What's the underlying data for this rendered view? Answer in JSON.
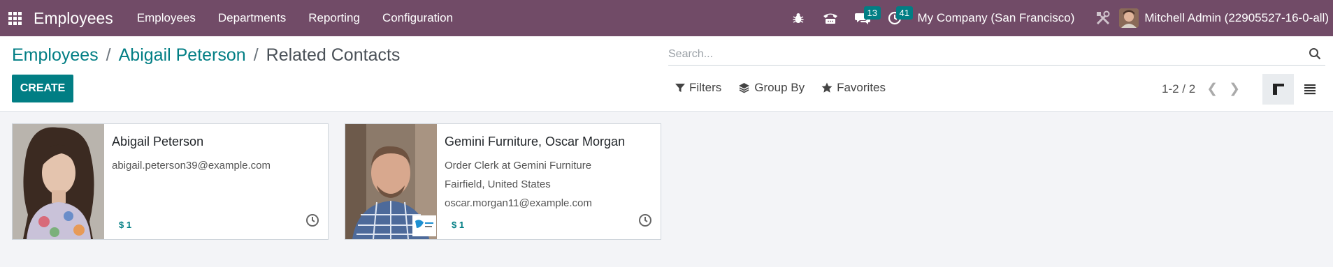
{
  "navbar": {
    "app_name": "Employees",
    "menu": [
      "Employees",
      "Departments",
      "Reporting",
      "Configuration"
    ],
    "messages_count": "13",
    "activities_count": "41",
    "company": "My Company (San Francisco)",
    "user": "Mitchell Admin (22905527-16-0-all)"
  },
  "breadcrumb": {
    "root": "Employees",
    "parent": "Abigail Peterson",
    "current": "Related Contacts",
    "separator": "/"
  },
  "create_label": "CREATE",
  "search": {
    "placeholder": "Search..."
  },
  "filters": {
    "filters": "Filters",
    "group_by": "Group By",
    "favorites": "Favorites"
  },
  "pager": {
    "text": "1-2 / 2"
  },
  "cards": [
    {
      "name": "Abigail Peterson",
      "lines": [
        "abigail.peterson39@example.com"
      ],
      "money": "$ 1"
    },
    {
      "name": "Gemini Furniture, Oscar Morgan",
      "lines": [
        "Order Clerk at Gemini Furniture",
        "Fairfield, United States",
        "oscar.morgan11@example.com"
      ],
      "money": "$ 1"
    }
  ],
  "colors": {
    "brand": "#714b67",
    "accent": "#017e84"
  }
}
